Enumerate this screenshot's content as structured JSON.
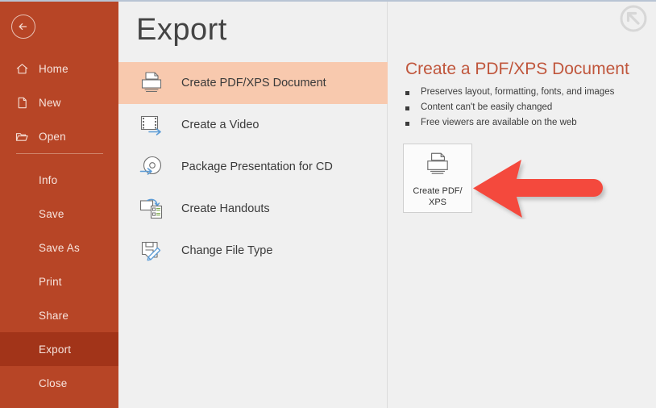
{
  "window": {
    "restore_icon": "restore-up-left-icon",
    "back_icon": "back-arrow-icon"
  },
  "sidebar": {
    "accent_color": "#b74526",
    "selected_color": "#a23419",
    "top_items": [
      {
        "label": "Home",
        "icon": "home-icon"
      },
      {
        "label": "New",
        "icon": "new-document-icon"
      },
      {
        "label": "Open",
        "icon": "open-folder-icon"
      }
    ],
    "bottom_items": [
      {
        "label": "Info",
        "selected": false
      },
      {
        "label": "Save",
        "selected": false
      },
      {
        "label": "Save As",
        "selected": false
      },
      {
        "label": "Print",
        "selected": false
      },
      {
        "label": "Share",
        "selected": false
      },
      {
        "label": "Export",
        "selected": true
      },
      {
        "label": "Close",
        "selected": false
      }
    ]
  },
  "main": {
    "title": "Export",
    "highlight_color": "#f8c9ae",
    "items": [
      {
        "label": "Create PDF/XPS Document",
        "icon": "printer-page-icon",
        "selected": true
      },
      {
        "label": "Create a Video",
        "icon": "film-strip-arrow-icon",
        "selected": false
      },
      {
        "label": "Package Presentation for CD",
        "icon": "cd-disc-arrow-icon",
        "selected": false
      },
      {
        "label": "Create Handouts",
        "icon": "slide-to-handout-icon",
        "selected": false
      },
      {
        "label": "Change File Type",
        "icon": "save-pencil-icon",
        "selected": false
      }
    ]
  },
  "detail": {
    "heading": "Create a PDF/XPS Document",
    "heading_color": "#c0563c",
    "bullets": [
      "Preserves layout, formatting, fonts, and images",
      "Content can't be easily changed",
      "Free viewers are available on the web"
    ],
    "button": {
      "line1": "Create PDF/",
      "line2": "XPS",
      "icon": "printer-page-icon"
    }
  },
  "annotation": {
    "arrow_color": "#f4483c",
    "icon": "left-pointing-arrow"
  }
}
